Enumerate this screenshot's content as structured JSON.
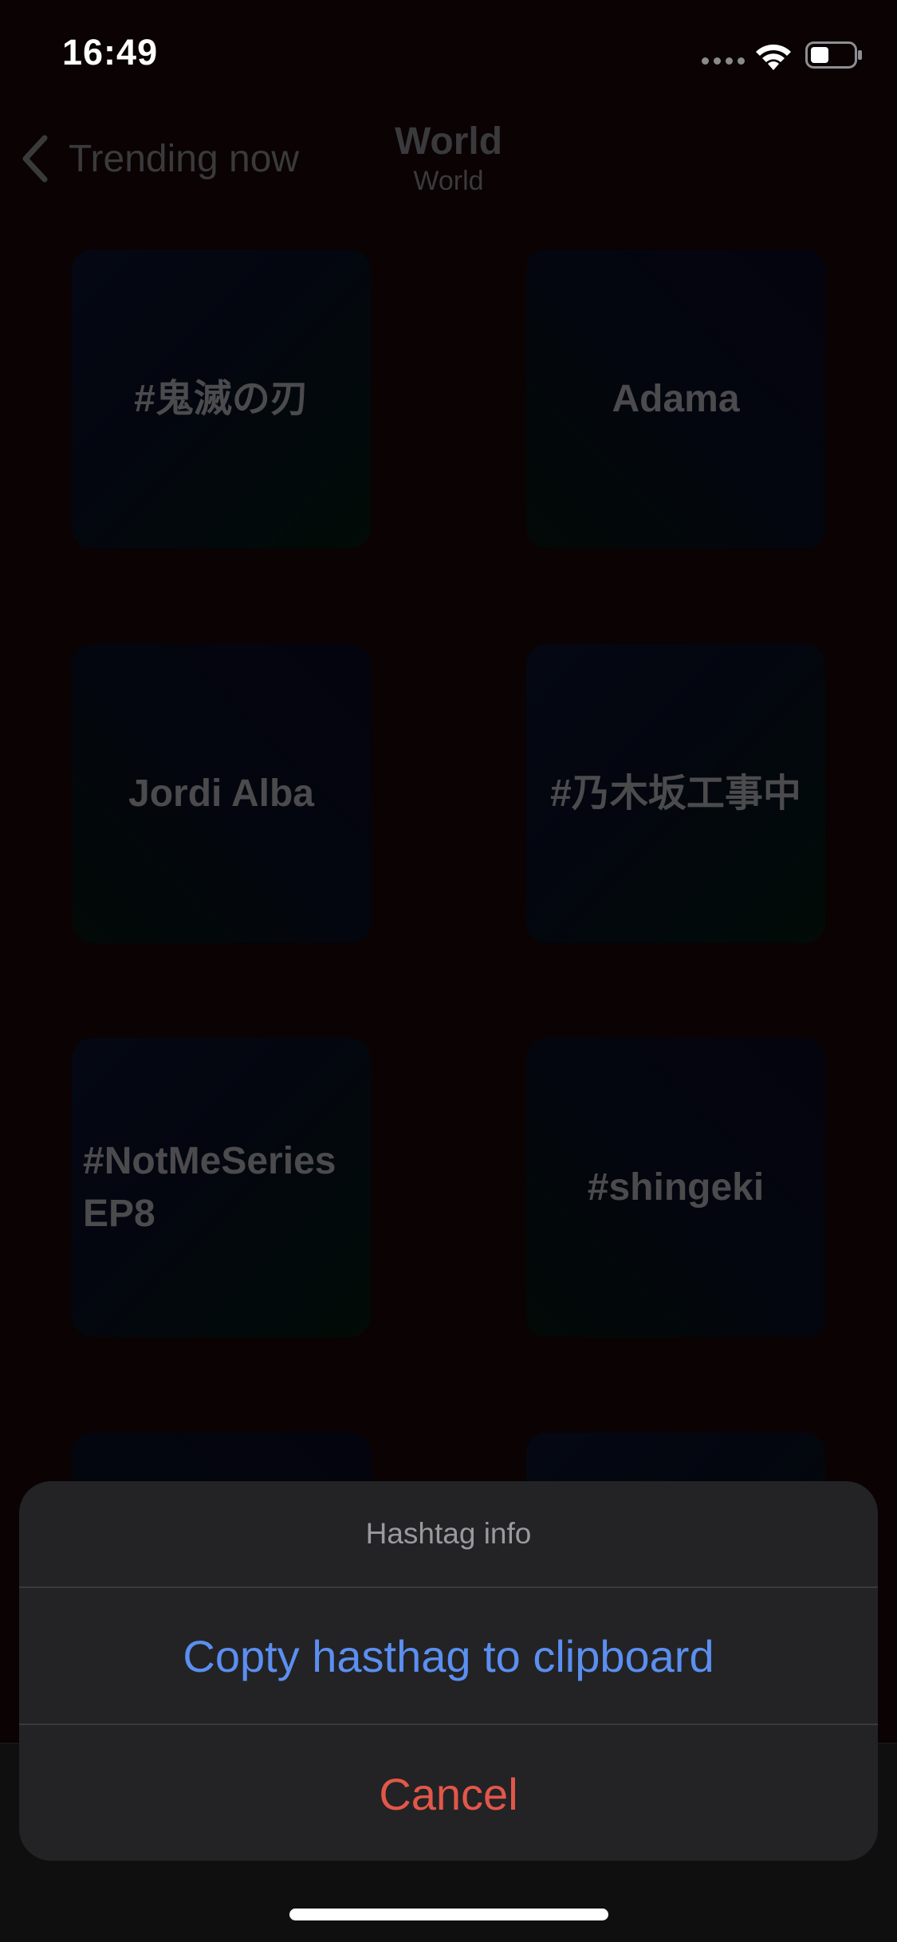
{
  "status_bar": {
    "time": "16:49"
  },
  "nav": {
    "back_label": "Trending now",
    "title": "World",
    "subtitle": "World"
  },
  "tiles": [
    {
      "label": "#鬼滅の刃"
    },
    {
      "label": "Adama"
    },
    {
      "label": "Jordi Alba"
    },
    {
      "label": "#乃木坂工事中"
    },
    {
      "label": "#NotMeSeries EP8"
    },
    {
      "label": "#shingeki"
    }
  ],
  "action_sheet": {
    "header": "Hashtag info",
    "copy_label": "Copty hasthag to clipboard",
    "cancel_label": "Cancel"
  },
  "colors": {
    "background": "#0a0203",
    "action_blue": "#5b8ff0",
    "action_red": "#e2574a",
    "sheet_bg": "#232325"
  },
  "icons": [
    "back-chevron-icon",
    "wifi-icon",
    "battery-icon",
    "signal-icon"
  ]
}
